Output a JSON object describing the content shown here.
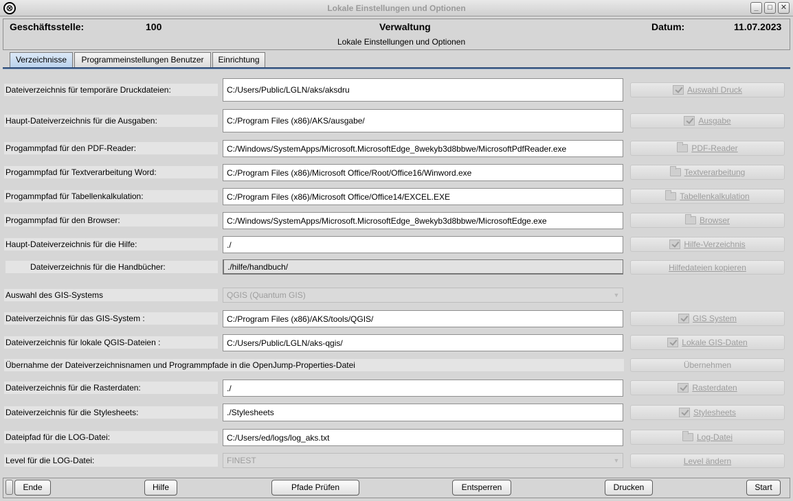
{
  "window": {
    "title": "Lokale Einstellungen und Optionen",
    "app_icon": "⊗",
    "minimize": "_",
    "maximize": "□",
    "close": "✕"
  },
  "header": {
    "branch_label": "Geschäftsstelle:",
    "branch_value": "100",
    "department": "Verwaltung",
    "subtitle": "Lokale Einstellungen und Optionen",
    "date_label": "Datum:",
    "date_value": "11.07.2023"
  },
  "tabs": [
    {
      "label": "Verzeichnisse",
      "active": true
    },
    {
      "label": "Programmeinstellungen Benutzer",
      "active": false
    },
    {
      "label": "Einrichtung",
      "active": false
    }
  ],
  "rows": [
    {
      "label": "Dateiverzeichnis für temporäre Druckdateien:",
      "value": "C:/Users/Public/LGLN/aks/aksdru",
      "button": "Auswahl Druck",
      "icon": "check-icon"
    },
    {
      "label": "Haupt-Dateiverzeichnis für die Ausgaben:",
      "value": "C:/Program Files (x86)/AKS/ausgabe/",
      "button": "Ausgabe",
      "icon": "check-icon"
    },
    {
      "label": "Progammpfad für den PDF-Reader:",
      "value": "C:/Windows/SystemApps/Microsoft.MicrosoftEdge_8wekyb3d8bbwe/MicrosoftPdfReader.exe",
      "button": "PDF-Reader",
      "icon": "folder-icon"
    },
    {
      "label": "Progammpfad für Textverarbeitung Word:",
      "value": "C:/Program Files (x86)/Microsoft Office/Root/Office16/Winword.exe",
      "button": "Textverarbeitung",
      "icon": "folder-icon"
    },
    {
      "label": "Progammpfad für Tabellenkalkulation:",
      "value": "C:/Program Files (x86)/Microsoft Office/Office14/EXCEL.EXE",
      "button": "Tabellenkalkulation",
      "icon": "folder-icon"
    },
    {
      "label": "Progammpfad für den Browser:",
      "value": "C:/Windows/SystemApps/Microsoft.MicrosoftEdge_8wekyb3d8bbwe/MicrosoftEdge.exe",
      "button": "Browser",
      "icon": "folder-icon"
    },
    {
      "label": "Haupt-Dateiverzeichnis für die Hilfe:",
      "value": "./",
      "button": "Hilfe-Verzeichnis",
      "icon": "check-icon"
    },
    {
      "label": "Dateiverzeichnis für die Handbücher:",
      "value": "./hilfe/handbuch/",
      "button": "Hilfedateien kopieren",
      "icon": ""
    },
    {
      "label": "Auswahl des GIS-Systems",
      "value": "QGIS (Quantum GIS)",
      "button": "",
      "icon": ""
    },
    {
      "label": "Dateiverzeichnis für das GIS-System :",
      "value": "C:/Program Files (x86)/AKS/tools/QGIS/",
      "button": "GIS System",
      "icon": "check-icon"
    },
    {
      "label": "Dateiverzeichnis für lokale QGIS-Dateien :",
      "value": "C:/Users/Public/LGLN/aks-qgis/",
      "button": "Lokale GIS-Daten",
      "icon": "check-icon"
    },
    {
      "label": "Übernahme der Dateiverzeichnisnamen und Programmpfade in die OpenJump-Properties-Datei",
      "value": "",
      "button": "Übernehmen",
      "icon": ""
    },
    {
      "label": "Dateiverzeichnis für die Rasterdaten:",
      "value": "./",
      "button": "Rasterdaten",
      "icon": "check-icon"
    },
    {
      "label": "Dateiverzeichnis für die Stylesheets:",
      "value": "./Stylesheets",
      "button": "Stylesheets",
      "icon": "check-icon"
    },
    {
      "label": "Dateipfad für die LOG-Datei:",
      "value": "C:/Users/ed/logs/log_aks.txt",
      "button": "Log-Datei",
      "icon": "folder-icon"
    },
    {
      "label": "Level für die LOG-Datei:",
      "value": "FINEST",
      "button": "Level ändern",
      "icon": ""
    }
  ],
  "footer": {
    "end": "Ende",
    "help": "Hilfe",
    "check_paths": "Pfade Prüfen",
    "unlock": "Entsperren",
    "print": "Drucken",
    "start": "Start"
  }
}
